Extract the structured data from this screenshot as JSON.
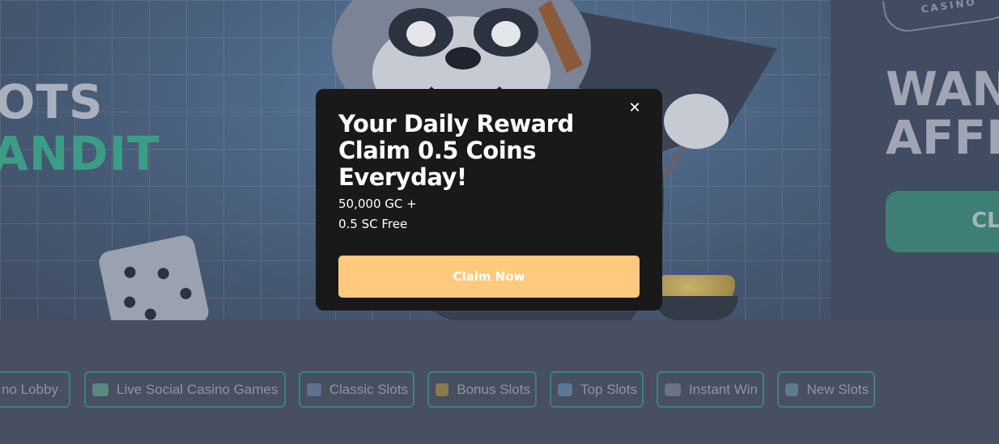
{
  "hero": {
    "title_line1": "OTS",
    "title_line2": "ANDIT",
    "casino_logo_text": "CASINO",
    "promo_title": "WAN\nAFFL",
    "promo_button_label": "CL"
  },
  "categories": [
    {
      "label": "no Lobby",
      "icon": "lobby-icon",
      "color": "#6a7c8f"
    },
    {
      "label": "Live Social Casino Games",
      "icon": "cards-icon",
      "color": "#5a8a7e"
    },
    {
      "label": "Classic Slots",
      "icon": "classic-slots-icon",
      "color": "#5d7290"
    },
    {
      "label": "Bonus Slots",
      "icon": "bonus-icon",
      "color": "#8a7a4c"
    },
    {
      "label": "Top Slots",
      "icon": "top-slots-icon",
      "color": "#5a7898"
    },
    {
      "label": "Instant Win",
      "icon": "rocket-icon",
      "color": "#6a7488"
    },
    {
      "label": "New Slots",
      "icon": "new-slots-icon",
      "color": "#5e7a8c"
    }
  ],
  "modal": {
    "close_label": "✕",
    "title": "Your Daily Reward Claim 0.5 Coins Everyday!",
    "subtitle_line1": "50,000 GC +",
    "subtitle_line2": "0.5 SC Free",
    "claim_label": "Claim Now",
    "accent_color": "#ffc97e"
  }
}
